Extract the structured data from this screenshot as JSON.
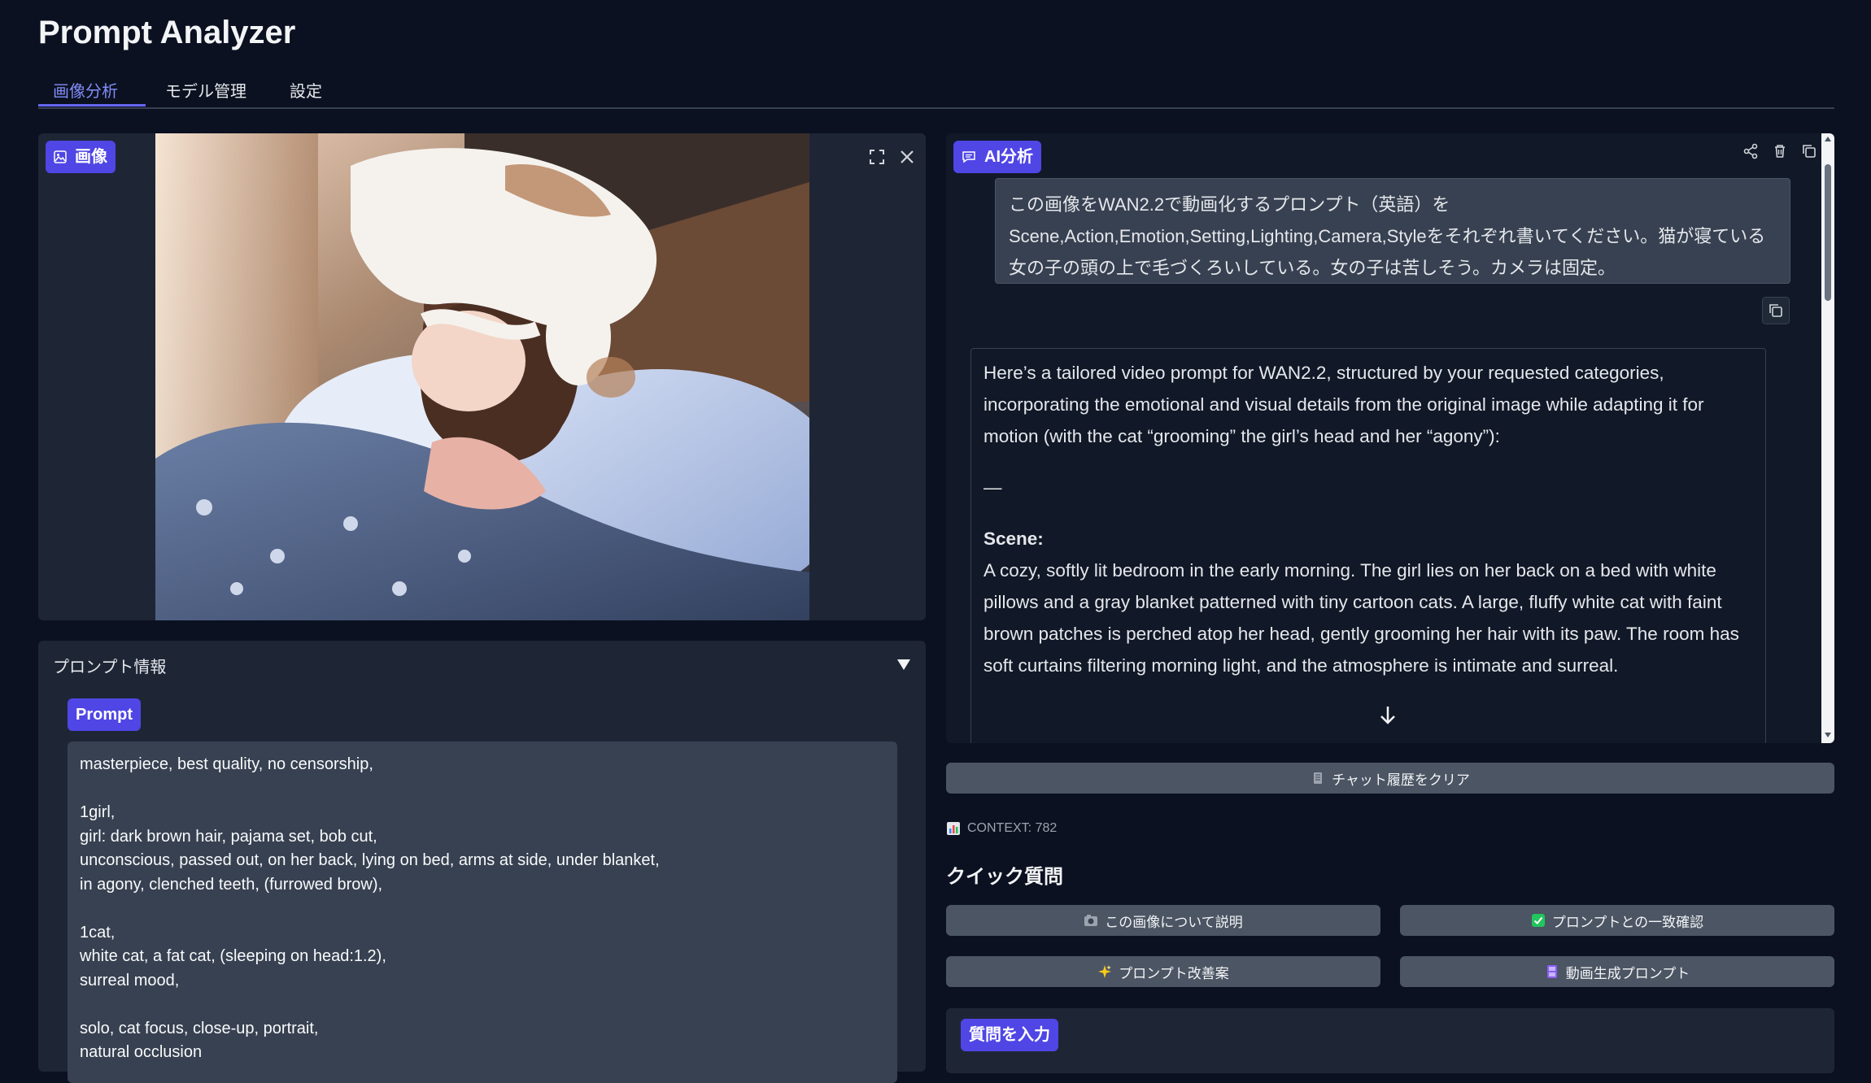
{
  "app": {
    "title": "Prompt Analyzer"
  },
  "tabs": [
    {
      "label": "画像分析",
      "active": true
    },
    {
      "label": "モデル管理",
      "active": false
    },
    {
      "label": "設定",
      "active": false
    }
  ],
  "image_panel": {
    "badge": "画像"
  },
  "prompt_info": {
    "title": "プロンプト情報",
    "badge": "Prompt",
    "text": "masterpiece, best quality, no censorship,\n\n1girl,\ngirl: dark brown hair, pajama set, bob cut,\nunconscious, passed out, on her back, lying on bed, arms at side, under blanket,\nin agony, clenched teeth, (furrowed brow),\n\n1cat,\nwhite cat, a fat cat, (sleeping on head:1.2),\nsurreal mood,\n\nsolo, cat focus, close-up, portrait,\nnatural occlusion"
  },
  "ai_panel": {
    "badge": "AI分析",
    "user_message": "この画像をWAN2.2で動画化するプロンプト（英語）を Scene,Action,Emotion,Setting,Lighting,Camera,Styleをそれぞれ書いてください。猫が寝ている女の子の頭の上で毛づくろいしている。女の子は苦しそう。カメラは固定。",
    "ai_intro": "Here’s a tailored video prompt for WAN2.2, structured by your requested categories, incorporating the emotional and visual details from the original image while adapting it for motion (with the cat “grooming” the girl’s head and her “agony”):",
    "ai_separator": "—",
    "ai_scene_heading": "Scene:",
    "ai_scene_text": "A cozy, softly lit bedroom in the early morning. The girl lies on her back on a bed with white pillows and a gray blanket patterned with tiny cartoon cats. A large, fluffy white cat with faint brown patches is perched atop her head, gently grooming her hair with its paw. The room has soft curtains filtering morning light, and the atmosphere is intimate and surreal."
  },
  "actions": {
    "clear_history": "チャット履歴をクリア",
    "context": "CONTEXT: 782"
  },
  "quick": {
    "title": "クイック質問",
    "buttons": [
      {
        "label": "この画像について説明",
        "icon": "camera-icon"
      },
      {
        "label": "プロンプトとの一致確認",
        "icon": "check-icon"
      },
      {
        "label": "プロンプト改善案",
        "icon": "sparkles-icon"
      },
      {
        "label": "動画生成プロンプト",
        "icon": "film-icon"
      }
    ]
  },
  "question_input": {
    "badge": "質問を入力"
  },
  "colors": {
    "accent": "#4f46e5",
    "background": "#0b1120",
    "panel": "#1e2636"
  }
}
